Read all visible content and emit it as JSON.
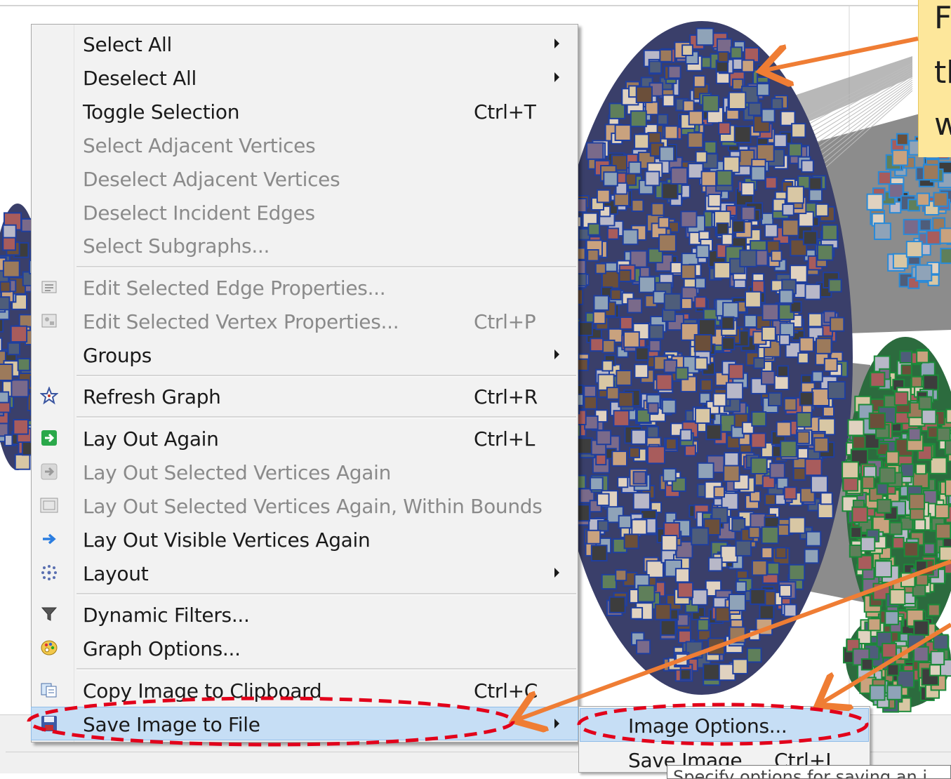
{
  "callout": {
    "lines": [
      "F",
      "th",
      "w"
    ]
  },
  "menu": {
    "items": [
      {
        "label": "Select All",
        "shortcut": "",
        "submenu": true,
        "disabled": false,
        "icon": ""
      },
      {
        "label": "Deselect All",
        "shortcut": "",
        "submenu": true,
        "disabled": false,
        "icon": ""
      },
      {
        "label": "Toggle Selection",
        "shortcut": "Ctrl+T",
        "submenu": false,
        "disabled": false,
        "icon": ""
      },
      {
        "label": "Select Adjacent Vertices",
        "shortcut": "",
        "submenu": false,
        "disabled": true,
        "icon": ""
      },
      {
        "label": "Deselect Adjacent Vertices",
        "shortcut": "",
        "submenu": false,
        "disabled": true,
        "icon": ""
      },
      {
        "label": "Deselect Incident Edges",
        "shortcut": "",
        "submenu": false,
        "disabled": true,
        "icon": ""
      },
      {
        "label": "Select Subgraphs...",
        "shortcut": "",
        "submenu": false,
        "disabled": true,
        "icon": ""
      },
      {
        "label": "Edit Selected Edge Properties...",
        "shortcut": "",
        "submenu": false,
        "disabled": true,
        "icon": "edge-properties-icon"
      },
      {
        "label": "Edit Selected Vertex Properties...",
        "shortcut": "Ctrl+P",
        "submenu": false,
        "disabled": true,
        "icon": "vertex-properties-icon"
      },
      {
        "label": "Groups",
        "shortcut": "",
        "submenu": true,
        "disabled": false,
        "icon": ""
      },
      {
        "label": "Refresh Graph",
        "shortcut": "Ctrl+R",
        "submenu": false,
        "disabled": false,
        "icon": "refresh-star-icon"
      },
      {
        "label": "Lay Out Again",
        "shortcut": "Ctrl+L",
        "submenu": false,
        "disabled": false,
        "icon": "green-arrow-icon"
      },
      {
        "label": "Lay Out Selected Vertices Again",
        "shortcut": "",
        "submenu": false,
        "disabled": true,
        "icon": "gray-arrow-icon"
      },
      {
        "label": "Lay Out Selected Vertices Again, Within Bounds",
        "shortcut": "",
        "submenu": false,
        "disabled": true,
        "icon": "bounds-icon"
      },
      {
        "label": "Lay Out Visible Vertices Again",
        "shortcut": "",
        "submenu": false,
        "disabled": false,
        "icon": "blue-arrow-icon"
      },
      {
        "label": "Layout",
        "shortcut": "",
        "submenu": true,
        "disabled": false,
        "icon": "layout-dots-icon"
      },
      {
        "label": "Dynamic Filters...",
        "shortcut": "",
        "submenu": false,
        "disabled": false,
        "icon": "funnel-icon"
      },
      {
        "label": "Graph Options...",
        "shortcut": "",
        "submenu": false,
        "disabled": false,
        "icon": "palette-icon"
      },
      {
        "label": "Copy Image to Clipboard",
        "shortcut": "Ctrl+C",
        "submenu": false,
        "disabled": false,
        "icon": "copy-icon"
      },
      {
        "label": "Save Image to File",
        "shortcut": "",
        "submenu": true,
        "disabled": false,
        "icon": "save-disk-icon",
        "highlighted": true
      }
    ]
  },
  "submenu": {
    "items": [
      {
        "label": "Image Options...",
        "shortcut": "",
        "highlighted": true
      },
      {
        "label": "Save Image",
        "shortcut": "Ctrl+I",
        "highlighted": false
      }
    ]
  },
  "tooltip": {
    "text": "Specify options for saving an i"
  },
  "colors": {
    "menu_bg": "#f2f2f2",
    "highlight": "#c6def5",
    "annotation_red": "#e2001a",
    "annotation_orange": "#ef7d34",
    "callout_bg": "#fde79b",
    "cluster_blue": "#1f3f9f",
    "cluster_green": "#1c8a3a",
    "edge_gray": "#8c8c8c"
  }
}
